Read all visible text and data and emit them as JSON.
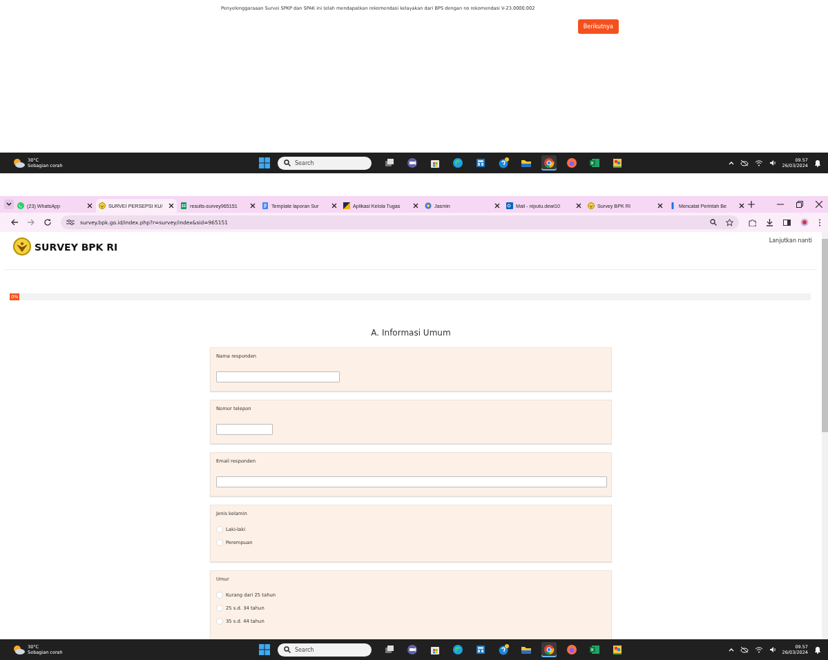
{
  "top_page": {
    "notice": "Penyelenggaraaan Survei SPKP dan SPAK ini telah mendapatkan rekomendasi kelayakan dari BPS dengan no rekomendasi V-23.0000.002",
    "next_button": "Berikutnya"
  },
  "taskbars": [
    {
      "weather_temp": "30°C",
      "weather_desc": "Sebagian cerah",
      "search_placeholder": "Search",
      "time": "09.57",
      "date": "26/03/2024",
      "apps": [
        {
          "kind": "taskview",
          "selected": false
        },
        {
          "kind": "meet",
          "selected": false
        },
        {
          "kind": "store",
          "selected": false
        },
        {
          "kind": "edge",
          "selected": false
        },
        {
          "kind": "calc",
          "selected": false
        },
        {
          "kind": "help",
          "selected": false
        },
        {
          "kind": "folder",
          "selected": false
        },
        {
          "kind": "chrome",
          "selected": true
        },
        {
          "kind": "firefox",
          "selected": false
        },
        {
          "kind": "excel",
          "selected": false
        },
        {
          "kind": "paint",
          "selected": false
        }
      ]
    },
    {
      "weather_temp": "30°C",
      "weather_desc": "Sebagian cerah",
      "search_placeholder": "Search",
      "time": "09.57",
      "date": "26/03/2024",
      "apps": [
        {
          "kind": "taskview",
          "selected": false
        },
        {
          "kind": "meet",
          "selected": false
        },
        {
          "kind": "store",
          "selected": false
        },
        {
          "kind": "edge",
          "selected": false
        },
        {
          "kind": "calc",
          "selected": false
        },
        {
          "kind": "help",
          "selected": false
        },
        {
          "kind": "folder",
          "selected": false
        },
        {
          "kind": "chrome",
          "selected": true
        },
        {
          "kind": "firefox",
          "selected": false
        },
        {
          "kind": "excel",
          "selected": false
        },
        {
          "kind": "paint",
          "selected": false
        }
      ]
    }
  ],
  "browser": {
    "tabs": [
      {
        "title": "(23) WhatsApp",
        "kind": "whatsapp",
        "selected": false
      },
      {
        "title": "SURVEI PERSEPSI KU/",
        "kind": "bpk",
        "selected": true
      },
      {
        "title": "results-survey965151",
        "kind": "sheets",
        "selected": false
      },
      {
        "title": "Template laporan Sur",
        "kind": "docs",
        "selected": false
      },
      {
        "title": "Aplikasi Kelola Tugas",
        "kind": "tasks",
        "selected": false
      },
      {
        "title": "Jasmin",
        "kind": "jasmin",
        "selected": false
      },
      {
        "title": "Mail - niputu.dewi10",
        "kind": "outlook",
        "selected": false
      },
      {
        "title": "Survey BPK RI",
        "kind": "bpk",
        "selected": false
      },
      {
        "title": "Mencatat Perintah Be",
        "kind": "bar",
        "selected": false
      }
    ],
    "url": "survey.bpk.go.id/index.php?r=survey/index&sid=965151"
  },
  "page": {
    "logo_text": "SURVEY BPK RI",
    "save_later_link": "Lanjutkan nanti",
    "progress": {
      "label": "0%",
      "level": 0
    },
    "section_title": "A. Informasi Umum",
    "questions": [
      {
        "kind": "text",
        "label": "Nama responden"
      },
      {
        "kind": "text",
        "label": "Nomor telepon"
      },
      {
        "kind": "text",
        "label": "Email responden"
      },
      {
        "kind": "radio",
        "label": "Jenis kelamin",
        "options": [
          {
            "label": "Laki-laki",
            "selected": false
          },
          {
            "label": "Perempuan",
            "selected": false
          }
        ]
      },
      {
        "kind": "radio",
        "label": "Umur",
        "options": [
          {
            "label": "Kurang dari 25 tahun",
            "selected": false
          },
          {
            "label": "25 s.d. 34 tahun",
            "selected": false
          },
          {
            "label": "35 s.d. 44 tahun",
            "selected": false
          }
        ]
      }
    ]
  }
}
